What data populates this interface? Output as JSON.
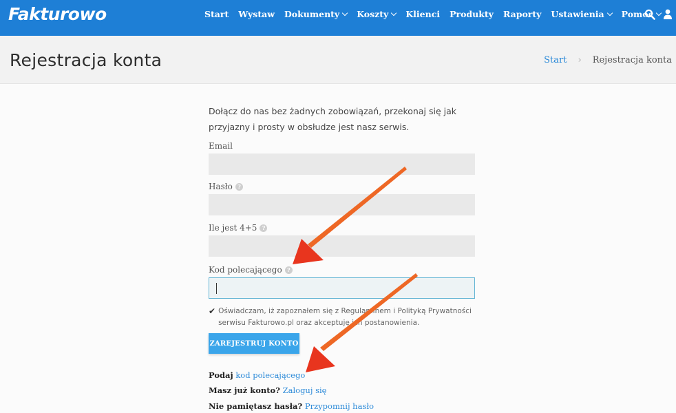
{
  "header": {
    "logo": "Fakturowo",
    "nav": [
      {
        "label": "Start",
        "dropdown": false
      },
      {
        "label": "Wystaw",
        "dropdown": false
      },
      {
        "label": "Dokumenty",
        "dropdown": true
      },
      {
        "label": "Koszty",
        "dropdown": true
      },
      {
        "label": "Klienci",
        "dropdown": false
      },
      {
        "label": "Produkty",
        "dropdown": false
      },
      {
        "label": "Raporty",
        "dropdown": false
      },
      {
        "label": "Ustawienia",
        "dropdown": true
      },
      {
        "label": "Pomoc",
        "dropdown": true
      }
    ],
    "icons": [
      "search-icon",
      "user-icon"
    ]
  },
  "title_band": {
    "title": "Rejestracja konta",
    "breadcrumb": {
      "home": "Start",
      "current": "Rejestracja konta"
    }
  },
  "form": {
    "intro": "Dołącz do nas bez żadnych zobowiązań, przekonaj się jak przyjazny i prosty w obsłudze jest nasz serwis.",
    "email_label": "Email",
    "email_value": "",
    "password_label": "Hasło",
    "password_value": "",
    "captcha_label": "Ile jest 4+5",
    "captcha_value": "",
    "referral_label": "Kod polecającego",
    "referral_value": "",
    "consent_text": "Oświadczam, iż zapoznałem się z Regulaminem i Polityką Prywatności serwisu Fakturowo.pl oraz akceptuję ich postanowienia.",
    "consent_checked": true,
    "submit_label": "ZAREJESTRUJ KONTO"
  },
  "footer_links": {
    "referral_prefix": "Podaj",
    "referral_link": "kod polecającego",
    "login_prefix": "Masz już konto?",
    "login_link": "Zaloguj się",
    "forgot_prefix": "Nie pamiętasz hasła?",
    "forgot_link": "Przypomnij hasło"
  },
  "colors": {
    "brand": "#1e7fd6",
    "link": "#2c8ad8",
    "button": "#3aa5ea",
    "annotation_arrow": "#e8351e"
  }
}
